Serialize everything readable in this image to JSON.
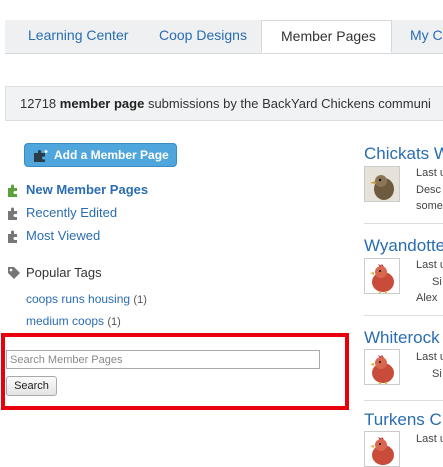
{
  "tabs": [
    {
      "label": "Learning Center",
      "active": false
    },
    {
      "label": "Coop Designs",
      "active": false
    },
    {
      "label": "Member Pages",
      "active": true
    },
    {
      "label": "My Cl",
      "active": false
    }
  ],
  "info": {
    "count": "12718",
    "bold": "member page",
    "rest": "submissions by the BackYard Chickens communi"
  },
  "add_button": {
    "label": "Add a Member Page"
  },
  "nav": [
    {
      "label": "New Member Pages"
    },
    {
      "label": "Recently Edited"
    },
    {
      "label": "Most Viewed"
    }
  ],
  "popular_tags": {
    "heading": "Popular Tags",
    "tags": [
      {
        "label": "coops runs housing",
        "count": "(1)"
      },
      {
        "label": "medium coops",
        "count": "(1)"
      }
    ]
  },
  "search": {
    "placeholder": "Search Member Pages",
    "button": "Search"
  },
  "right_list": [
    {
      "title": "Chickats W",
      "lines": [
        "Last u",
        "Desc",
        "some"
      ]
    },
    {
      "title": "Wyandotte",
      "lines": [
        "Last u",
        "Si",
        "Alex"
      ]
    },
    {
      "title": "Whiterock",
      "lines": [
        "Last u",
        "Si"
      ]
    },
    {
      "title": "Turkens C",
      "lines": [
        "Last u"
      ]
    }
  ],
  "colors": {
    "link": "#2a6db0",
    "highlight": "#e8000d",
    "button": "#4fa6dc"
  }
}
